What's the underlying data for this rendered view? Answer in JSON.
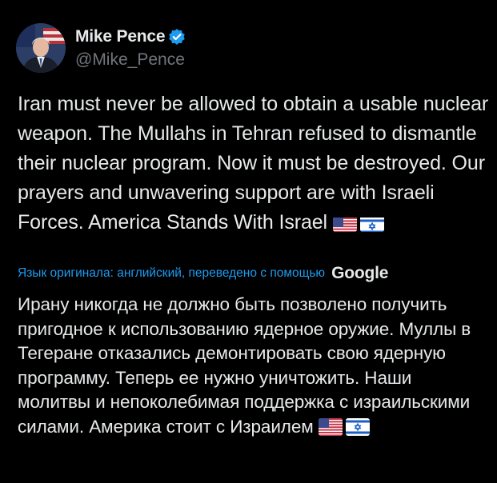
{
  "author": {
    "display_name": "Mike Pence",
    "handle": "@Mike_Pence",
    "verified": true,
    "avatar": "portrait-photo"
  },
  "tweet": {
    "text": "Iran must never be allowed to obtain a usable nuclear weapon. The Mullahs in Tehran refused to dismantle their nuclear program. Now it must be destroyed. Our prayers and unwavering support are with Israeli Forces. America Stands With Israel",
    "flags": [
      "us-flag-emoji",
      "israel-flag-emoji"
    ]
  },
  "translation": {
    "note": "Язык оригинала: английский, переведено с помощью",
    "provider": "Google",
    "text": "Ирану никогда не должно быть позволено получить пригодное к использованию ядерное оружие. Муллы в Тегеране отказались демонтировать свою ядерную программу. Теперь ее нужно уничтожить. Наши молитвы и непоколебимая поддержка с израильскими силами. Америка стоит с Израилем"
  },
  "colors": {
    "background": "#000000",
    "text": "#e7e9ea",
    "muted": "#71767b",
    "accent": "#1d9bf0"
  }
}
